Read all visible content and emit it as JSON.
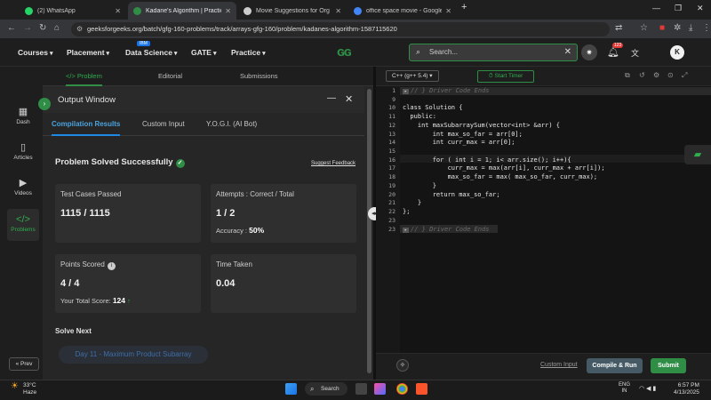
{
  "browser": {
    "tabs": [
      {
        "title": "(2) WhatsApp",
        "color": "#25d366"
      },
      {
        "title": "Kadane's Algorithm | Practice |",
        "color": "#2f8d46"
      },
      {
        "title": "Movie Suggestions for Org Stu",
        "color": "#cccccc"
      },
      {
        "title": "office space movie - Google Se",
        "color": "#4285f4"
      }
    ],
    "new_tab": "+",
    "url": "geeksforgeeks.org/batch/gfg-160-problems/track/arrays-gfg-160/problem/kadanes-algorithm-1587115620"
  },
  "header": {
    "menu": [
      {
        "label": "Courses"
      },
      {
        "label": "Placement"
      },
      {
        "label": "Data Science"
      },
      {
        "label": "GATE"
      },
      {
        "label": "Practice"
      }
    ],
    "ibm_badge": "IBM",
    "search_placeholder": "Search...",
    "notification_count": "123",
    "avatar_letter": "K"
  },
  "problem_tabs": [
    {
      "label": "</> Problem"
    },
    {
      "label": "Editorial"
    },
    {
      "label": "Submissions"
    }
  ],
  "sidebar": {
    "items": [
      {
        "label": "Dash",
        "icon": "grid-icon"
      },
      {
        "label": "Articles",
        "icon": "book-icon"
      },
      {
        "label": "Videos",
        "icon": "video-icon"
      },
      {
        "label": "Problems",
        "icon": "code-icon"
      }
    ],
    "prev_label": "« Prev"
  },
  "output": {
    "title": "Output Window",
    "tabs": [
      {
        "label": "Compilation Results"
      },
      {
        "label": "Custom Input"
      },
      {
        "label": "Y.O.G.I. (AI Bot)"
      }
    ],
    "status": "Problem Solved Successfully",
    "feedback": "Suggest Feedback",
    "test_cases_label": "Test Cases Passed",
    "test_cases_value": "1115 / 1115",
    "attempts_label": "Attempts : Correct / Total",
    "attempts_value": "1 / 2",
    "accuracy_label": "Accuracy :",
    "accuracy_value": "50%",
    "points_label": "Points Scored",
    "points_value": "4 / 4",
    "total_score_label": "Your Total Score:",
    "total_score_value": "124",
    "time_label": "Time Taken",
    "time_value": "0.04",
    "solve_next_label": "Solve Next",
    "next_problem": "Day 11 - Maximum Product Subarray"
  },
  "editor": {
    "language": "C++ (g++ 5.4)",
    "timer_label": "Start Timer",
    "lines": [
      {
        "n": "1",
        "text": "// } Driver Code Ends",
        "comment": true
      },
      {
        "n": "9",
        "text": ""
      },
      {
        "n": "10",
        "text": "class Solution {"
      },
      {
        "n": "11",
        "text": "  public:"
      },
      {
        "n": "12",
        "text": "    int maxSubarraySum(vector<int> &arr) {"
      },
      {
        "n": "13",
        "text": "        int max_so_far = arr[0];"
      },
      {
        "n": "14",
        "text": "        int curr_max = arr[0];"
      },
      {
        "n": "15",
        "text": ""
      },
      {
        "n": "16",
        "text": "        for ( int i = 1; i< arr.size(); i++){"
      },
      {
        "n": "17",
        "text": "            curr_max = max(arr[i], curr_max + arr[i]);"
      },
      {
        "n": "18",
        "text": "            max_so_far = max( max_so_far, curr_max);"
      },
      {
        "n": "19",
        "text": "        }"
      },
      {
        "n": "20",
        "text": "        return max_so_far;"
      },
      {
        "n": "21",
        "text": "    }"
      },
      {
        "n": "22",
        "text": "};"
      },
      {
        "n": "23",
        "text": ""
      },
      {
        "n": "23",
        "text": "// } Driver Code Ends",
        "comment": true
      }
    ],
    "custom_input": "Custom Input",
    "compile_run": "Compile & Run",
    "submit": "Submit"
  },
  "taskbar": {
    "temp": "33°C",
    "weather": "Haze",
    "search": "Search",
    "lang_top": "ENG",
    "lang_bottom": "IN",
    "time": "6:57 PM",
    "date": "4/13/2025"
  }
}
